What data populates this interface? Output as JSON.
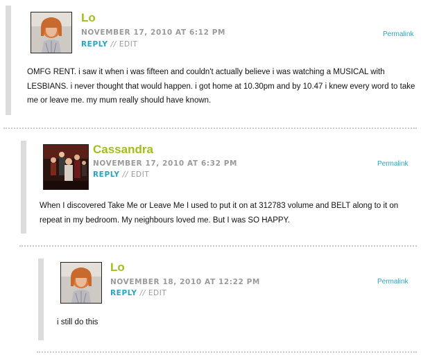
{
  "comments": [
    {
      "author": "Lo",
      "date": "NOVEMBER 17, 2010 AT 6:12 PM",
      "reply_label": "REPLY",
      "separator": "//",
      "edit_label": "EDIT",
      "permalink_label": "Permalink",
      "body": "OMFG RENT. i saw it when i was fifteen and couldn't actually believe i was watching a MUSICAL with LESBIANS. i never thought that would happen. i got home at 10.30pm and by 10.47 i knew every word to take me or leave me. my mum really should have known."
    },
    {
      "author": "Cassandra",
      "date": "NOVEMBER 17, 2010 AT 6:32 PM",
      "reply_label": "REPLY",
      "separator": "//",
      "edit_label": "EDIT",
      "permalink_label": "Permalink",
      "body": "When I discovered Take Me or Leave Me I used to put it on at 312783 volume and BELT along to it on repeat in my bedroom. My neighbours loved me. But I was SO HAPPY."
    },
    {
      "author": "Lo",
      "date": "NOVEMBER 18, 2010 AT 12:22 PM",
      "reply_label": "REPLY",
      "separator": "//",
      "edit_label": "EDIT",
      "permalink_label": "Permalink",
      "body": "i still do this"
    }
  ],
  "colors": {
    "author": "#a3bd1e",
    "link": "#2aa4be",
    "meta": "#9a9a9a",
    "thread_bar": "#dcdcdc"
  }
}
